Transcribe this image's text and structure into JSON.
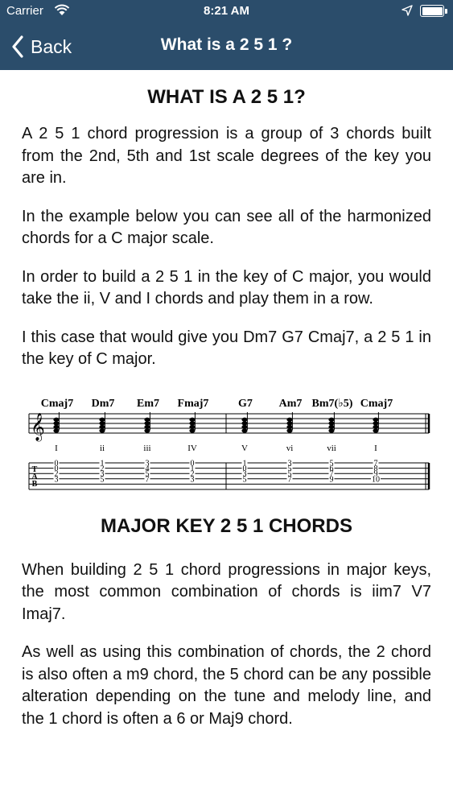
{
  "status_bar": {
    "carrier": "Carrier",
    "time": "8:21 AM"
  },
  "nav": {
    "back_label": "Back",
    "title": "What is a 2 5 1 ?"
  },
  "article": {
    "heading": "WHAT IS A 2 5 1?",
    "paragraphs": [
      "A 2 5 1 chord progression is a group of 3 chords built from the 2nd, 5th and 1st scale degrees of the key you are in.",
      "In the example below you can see all of the harmonized chords for a C major scale.",
      "In order to build a 2 5 1 in the key of C major, you would take the ii, V and I chords and play them in a row.",
      "I this case that would give you Dm7 G7 Cmaj7, a 2 5 1 in the key of C major."
    ],
    "notation": {
      "chords": [
        "Cmaj7",
        "Dm7",
        "Em7",
        "Fmaj7",
        "G7",
        "Am7",
        "Bm7(♭5)",
        "Cmaj7"
      ],
      "degrees": [
        "I",
        "ii",
        "iii",
        "IV",
        "V",
        "vi",
        "vii",
        "I"
      ],
      "tab_label": [
        "T",
        "A",
        "B"
      ],
      "tab_columns": [
        [
          "0",
          "0",
          "2",
          "3"
        ],
        [
          "1",
          "2",
          "3",
          "5"
        ],
        [
          "3",
          "4",
          "5",
          "7"
        ],
        [
          "0",
          "1",
          "2",
          "3"
        ],
        [
          "1",
          "0",
          "3",
          "5"
        ],
        [
          "3",
          "5",
          "5",
          "7"
        ],
        [
          "5",
          "6",
          "7",
          "9"
        ],
        [
          "7",
          "8",
          "9",
          "10"
        ]
      ]
    },
    "subheading": "MAJOR KEY 2 5 1 CHORDS",
    "paragraphs2": [
      "When building 2 5 1 chord progressions in major keys, the most common combination of chords is iim7 V7 Imaj7.",
      "As well as using this combination of chords, the 2 chord is also often a m9 chord, the 5 chord can be any possible alteration depending on the tune and melody line, and the 1 chord is often a 6 or Maj9 chord."
    ]
  }
}
